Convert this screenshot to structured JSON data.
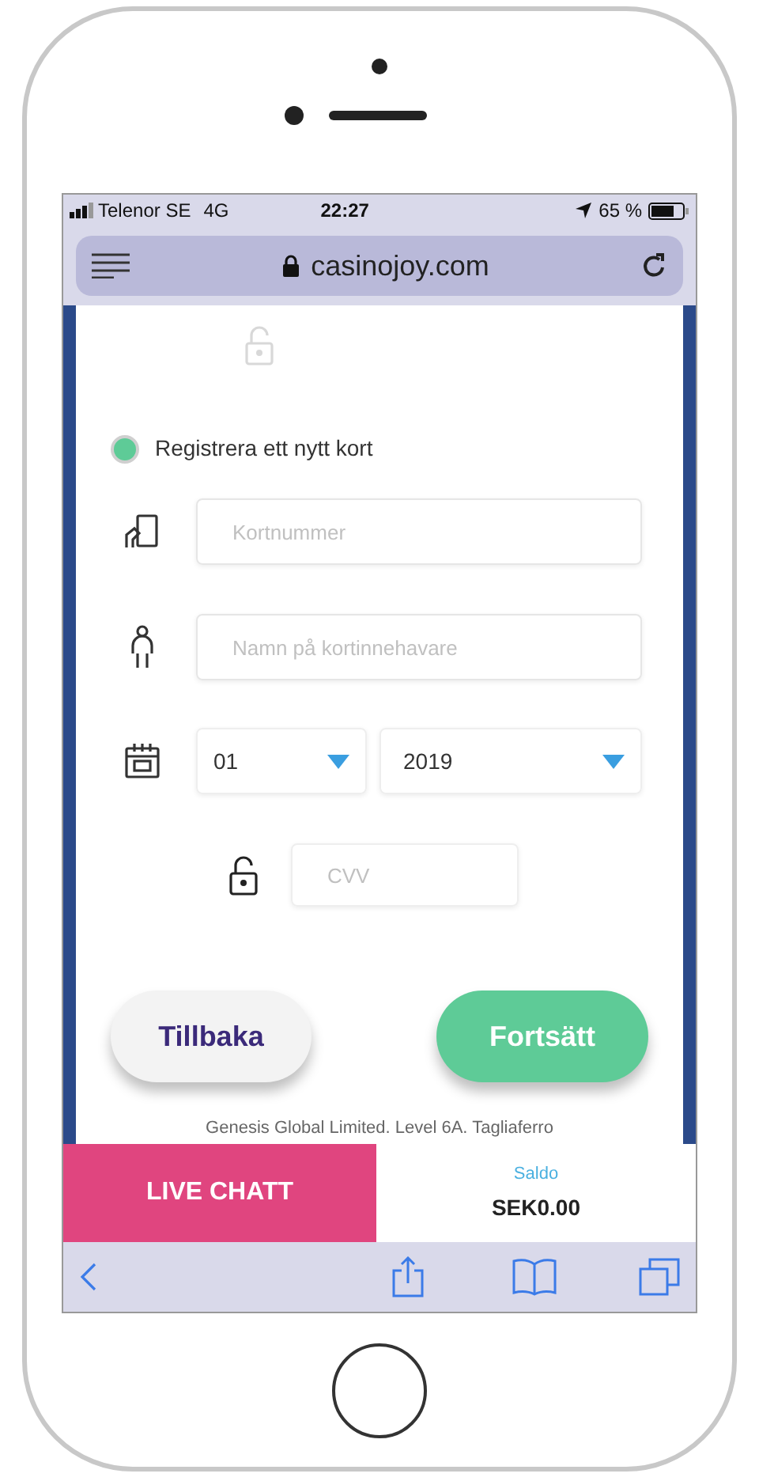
{
  "status_bar": {
    "carrier": "Telenor SE",
    "network": "4G",
    "time": "22:27",
    "battery": "65 %"
  },
  "browser": {
    "url": "casinojoy.com"
  },
  "card_form": {
    "option": {
      "label": "Registrera ett nytt kort",
      "selected": true
    },
    "card_number": {
      "placeholder": "Kortnummer"
    },
    "holder_name": {
      "placeholder": "Namn på kortinnehavare"
    },
    "month": {
      "value": "01"
    },
    "year": {
      "value": "2019"
    },
    "cvv": {
      "placeholder": "CVV"
    },
    "buttons": [
      {
        "label": "Tillbaka",
        "kind": "secondary"
      },
      {
        "label": "Fortsätt",
        "kind": "primary"
      }
    ],
    "footer": "Genesis Global Limited. Level 6A. Tagliaferro"
  },
  "bottom_bar": {
    "chat": "LIVE CHATT",
    "balance_label": "Saldo",
    "balance": "SEK0.00"
  }
}
